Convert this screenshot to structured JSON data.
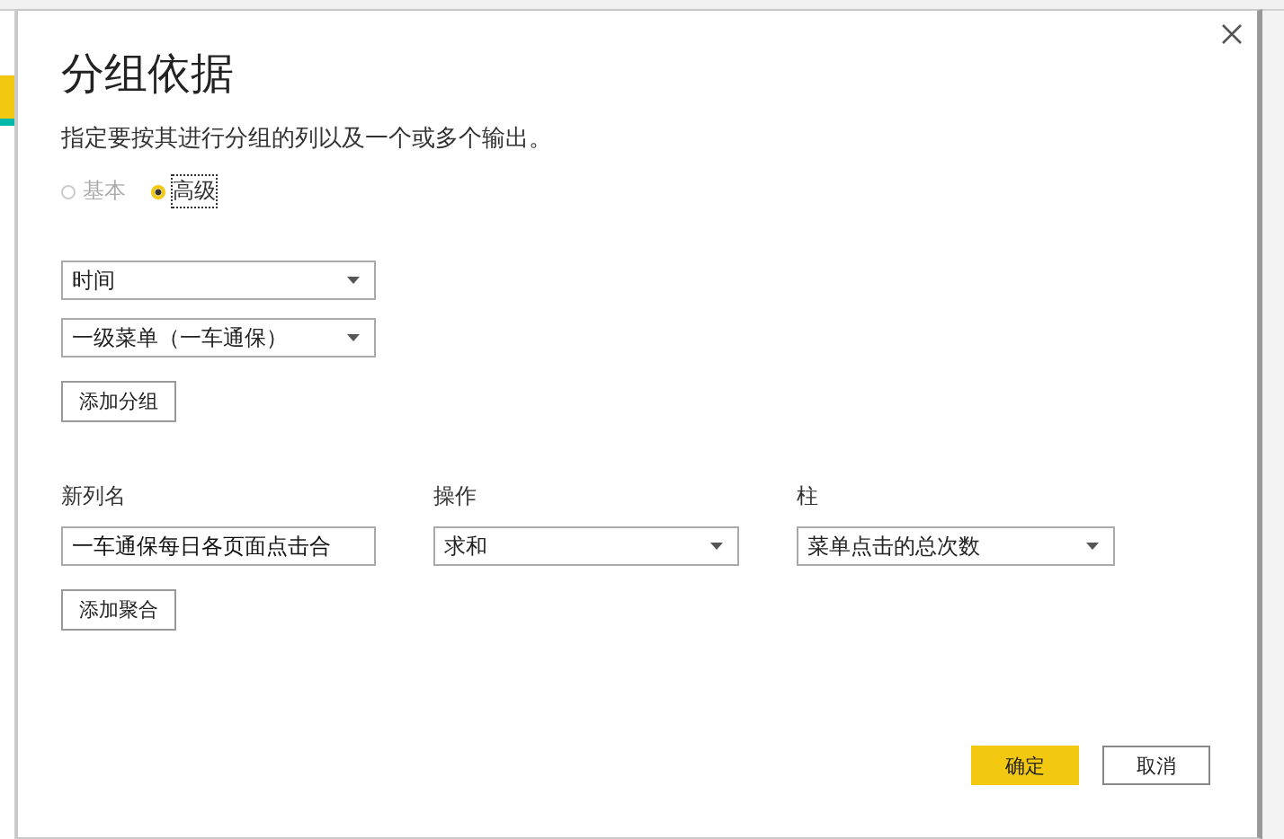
{
  "dialog": {
    "title": "分组依据",
    "description": "指定要按其进行分组的列以及一个或多个输出。",
    "modes": [
      {
        "label": "基本",
        "selected": false,
        "disabled": true
      },
      {
        "label": "高级",
        "selected": true,
        "disabled": false
      }
    ],
    "group_by": [
      {
        "value": "时间"
      },
      {
        "value": "一级菜单（一车通保）"
      }
    ],
    "add_group_button": "添加分组",
    "aggregation_headers": [
      "新列名",
      "操作",
      "柱"
    ],
    "aggregations": [
      {
        "new_column_name": "一车通保每日各页面点击合",
        "operation": "求和",
        "column": "菜单点击的总次数"
      }
    ],
    "add_aggregation_button": "添加聚合",
    "buttons": [
      {
        "label": "确定",
        "kind": "primary"
      },
      {
        "label": "取消",
        "kind": "secondary"
      }
    ]
  }
}
